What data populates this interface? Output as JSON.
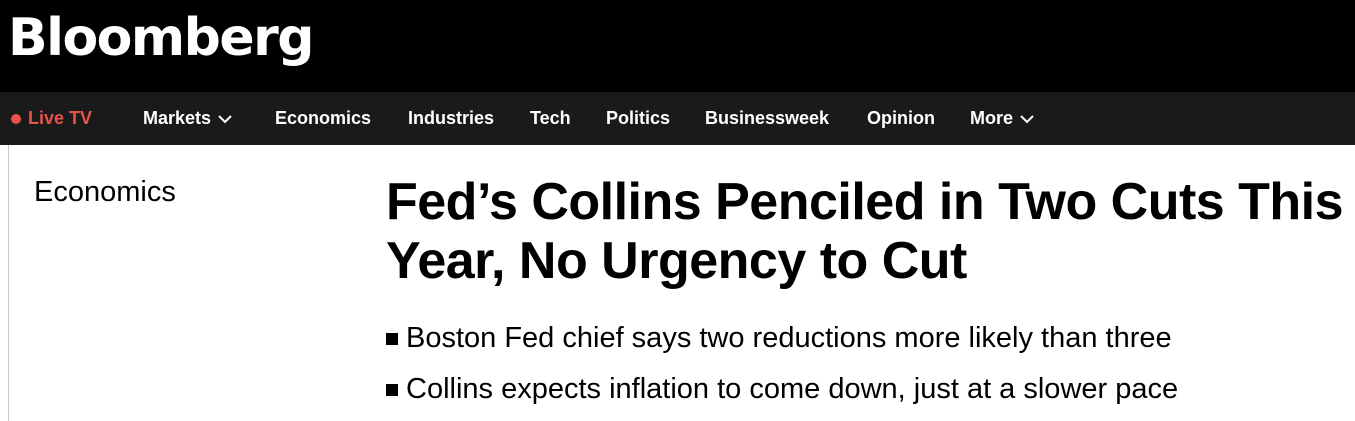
{
  "brand": {
    "logo": "Bloomberg"
  },
  "nav": {
    "live_tv": "Live TV",
    "items": [
      "Markets",
      "Economics",
      "Industries",
      "Tech",
      "Politics",
      "Businessweek",
      "Opinion",
      "More"
    ]
  },
  "article": {
    "section": "Economics",
    "headline": "Fed’s Collins Penciled in Two Cuts This Year, No Urgency to Cut",
    "bullets": [
      "Boston Fed chief says two reductions more likely than three",
      "Collins expects inflation to come down, just at a slower pace"
    ]
  },
  "colors": {
    "live_accent": "#e8534a",
    "nav_bg": "#1a1a1a",
    "header_bg": "#000000"
  }
}
